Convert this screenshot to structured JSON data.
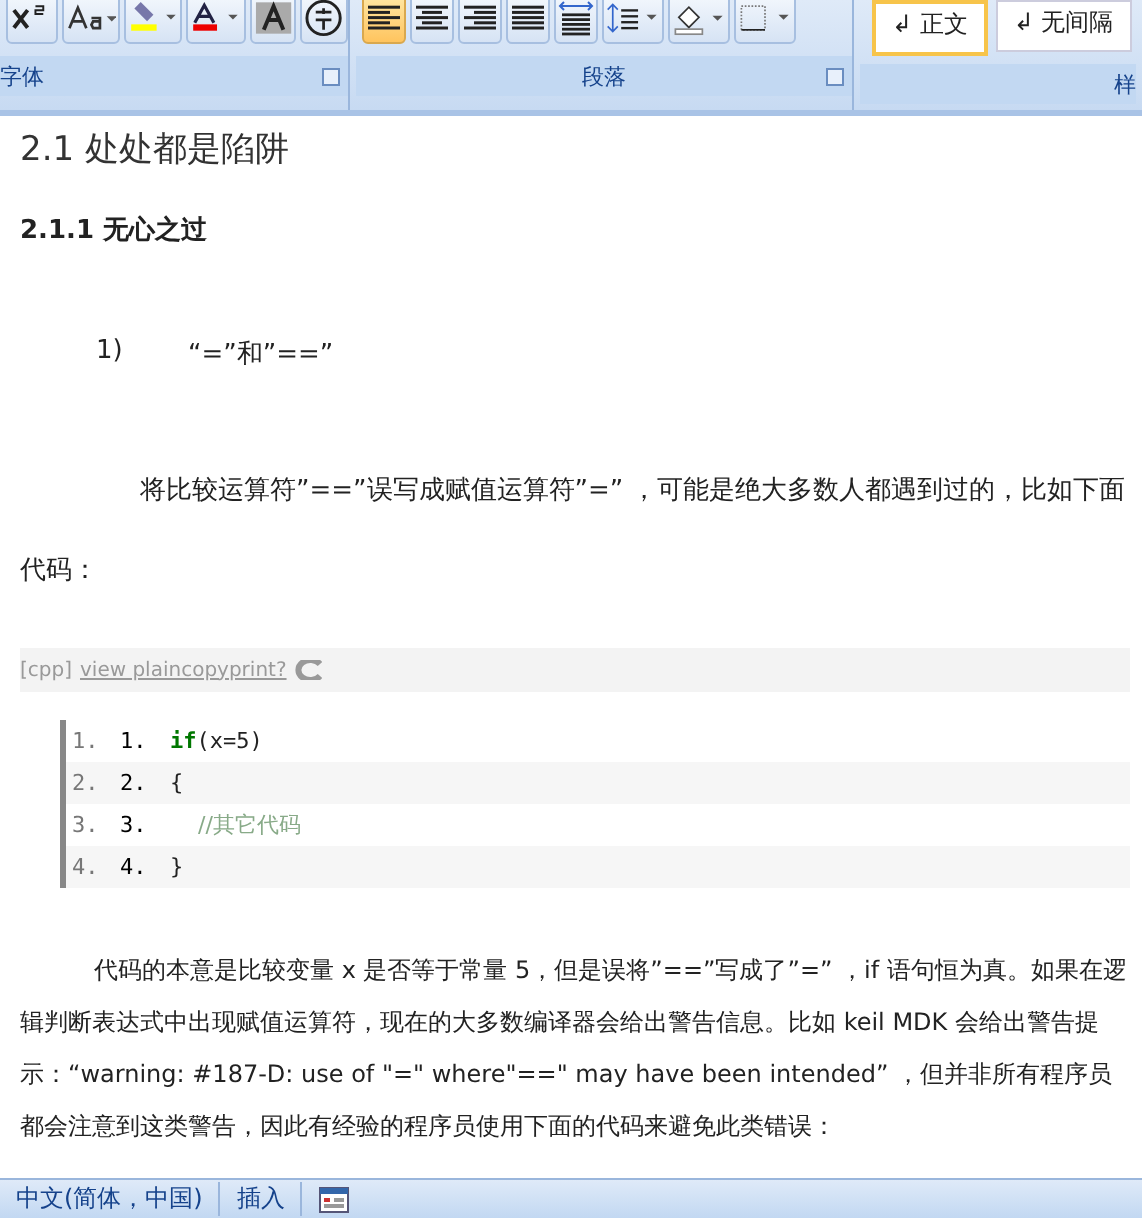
{
  "ribbon": {
    "groups": [
      {
        "label": "字体",
        "buttons": [
          {
            "kind": "superscript",
            "selected": false
          },
          {
            "kind": "case",
            "selected": false
          },
          {
            "kind": "highlight",
            "selected": false
          },
          {
            "kind": "fontcolor",
            "selected": false
          },
          {
            "kind": "shade",
            "selected": false
          },
          {
            "kind": "enclose",
            "selected": false
          }
        ]
      },
      {
        "label": "段落",
        "buttons": [
          {
            "kind": "alignleft",
            "selected": true
          },
          {
            "kind": "center",
            "selected": false
          },
          {
            "kind": "alignright",
            "selected": false
          },
          {
            "kind": "justify",
            "selected": false
          },
          {
            "kind": "distribute",
            "selected": false
          },
          {
            "kind": "spacing",
            "selected": false
          },
          {
            "kind": "fill",
            "selected": false
          },
          {
            "kind": "border",
            "selected": false
          }
        ]
      },
      {
        "label": "样",
        "styles": [
          {
            "label": "↲ 正文",
            "selected": true
          },
          {
            "label": "↲ 无间隔",
            "selected": false
          }
        ]
      }
    ]
  },
  "document": {
    "heading": "2.1 处处都是陷阱",
    "subheading": "2.1.1 无心之过",
    "list_item": {
      "number": "1)",
      "text": "“=”和”==”"
    },
    "paragraph_1": "将比较运算符”==”误写成赋值运算符”=” ，可能是绝大多数人都遇到过的，比如下面代码：",
    "code_toolbar": {
      "lang": "[cpp]",
      "link": "view plaincopyprint?"
    },
    "code_lines": [
      {
        "gutter": "1.",
        "number": "1.",
        "kind": "if",
        "keyword": "if",
        "text": "(x=5)"
      },
      {
        "gutter": "2.",
        "number": "2.",
        "kind": "plain",
        "text": "{"
      },
      {
        "gutter": "3.",
        "number": "3.",
        "kind": "comment",
        "text": "    //其它代码"
      },
      {
        "gutter": "4.",
        "number": "4.",
        "kind": "plain",
        "text": "}"
      }
    ],
    "paragraph_2": "代码的本意是比较变量 x 是否等于常量 5，但是误将”==”写成了”=” ，if 语句恒为真。如果在逻辑判断表达式中出现赋值运算符，现在的大多数编译器会给出警告信息。比如 keil MDK 会给出警告提示：“warning:  #187-D: use of \"=\" where\"==\" may have been intended” ，但并非所有程序员都会注意到这类警告，因此有经验的程序员使用下面的代码来避免此类错误："
  },
  "status_bar": {
    "language": "中文(简体，中国)",
    "mode": "插入"
  }
}
